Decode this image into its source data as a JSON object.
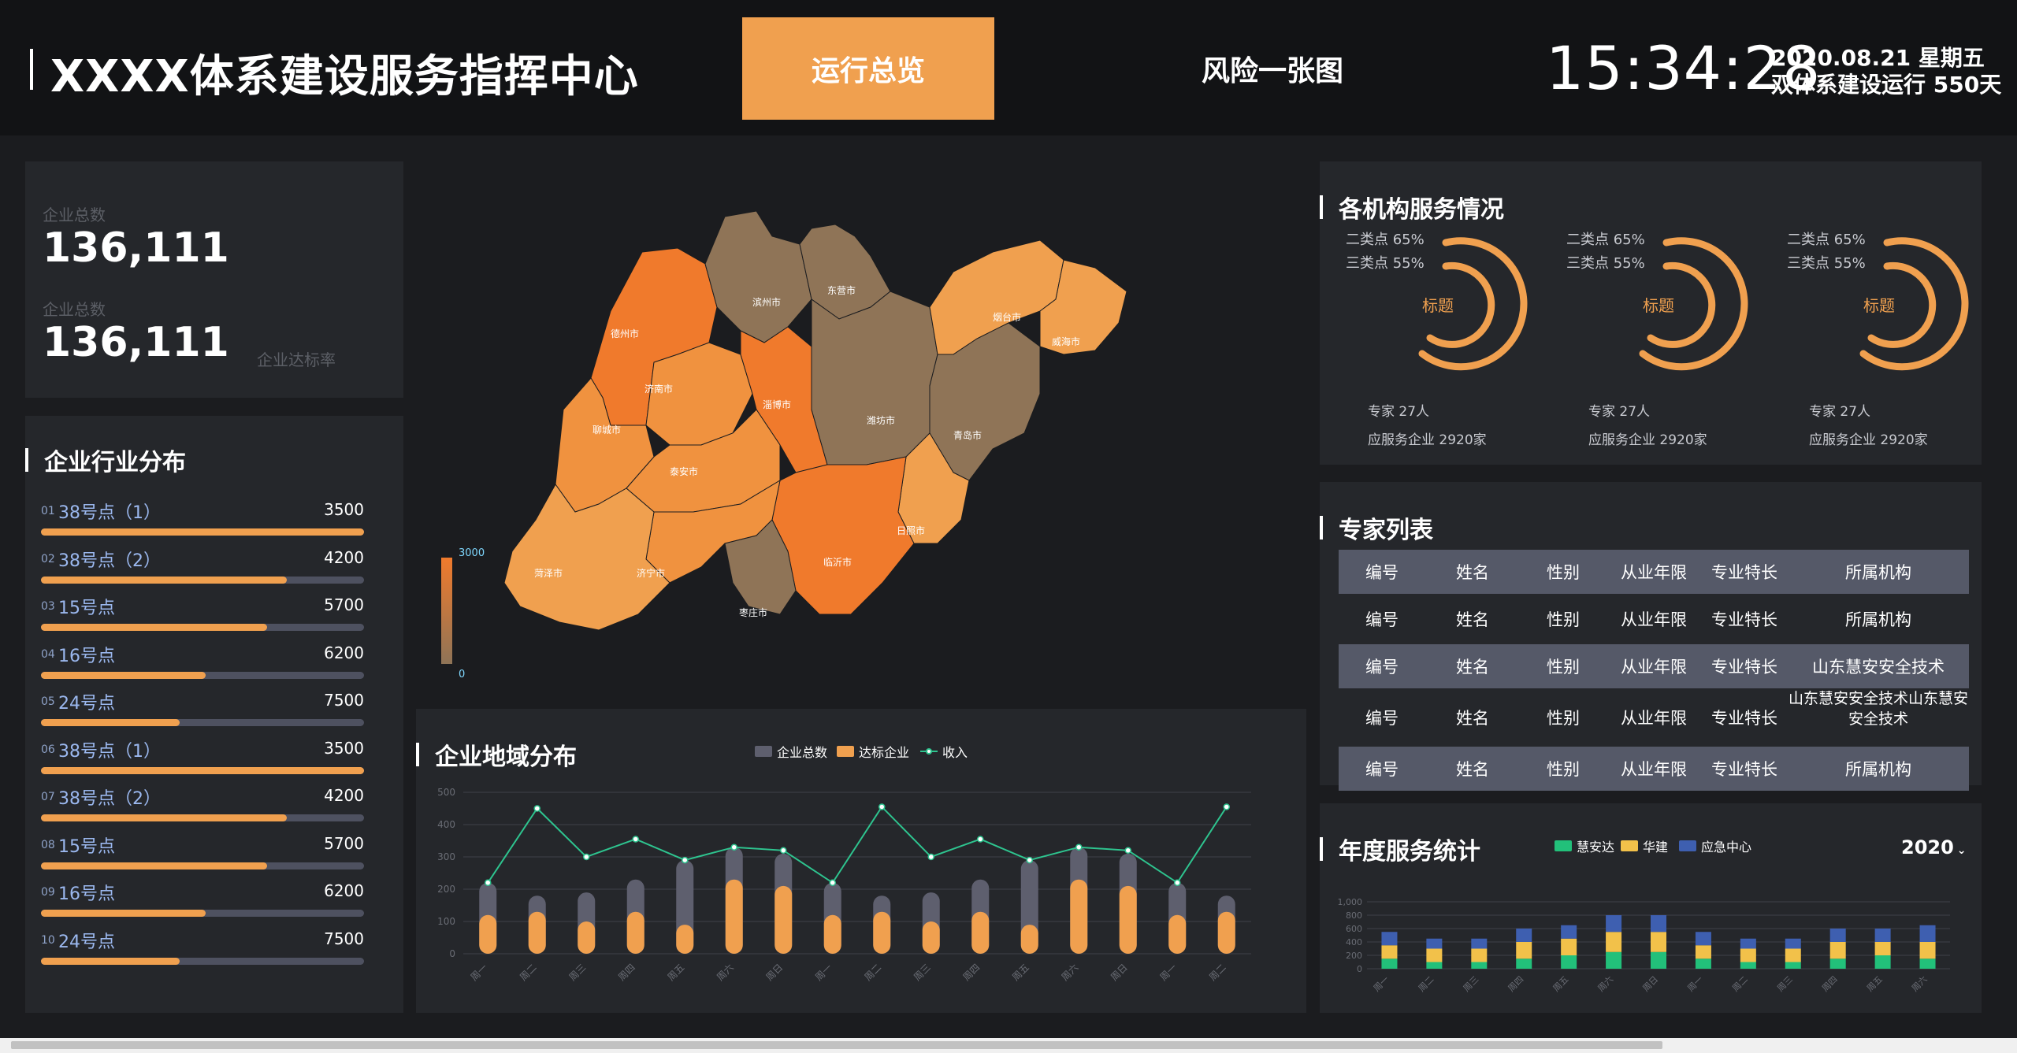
{
  "header": {
    "title": "XXXX体系建设服务指挥中心",
    "tabs": [
      {
        "label": "运行总览"
      },
      {
        "label": "风险一张图"
      }
    ],
    "clock": "15:34:28",
    "date": "2020.08.21 星期五",
    "run_days": "双体系建设运行 550天"
  },
  "kpi": {
    "label1": "企业总数",
    "value1": "136,111",
    "label2": "企业总数",
    "value2": "136,111",
    "rate_label": "企业达标率"
  },
  "industry": {
    "title": "企业行业分布",
    "items": [
      {
        "idx": "01",
        "name": "38号点（1）",
        "value": "3500",
        "pct": 1.0
      },
      {
        "idx": "02",
        "name": "38号点（2）",
        "value": "4200",
        "pct": 0.76
      },
      {
        "idx": "03",
        "name": "15号点",
        "value": "5700",
        "pct": 0.7
      },
      {
        "idx": "04",
        "name": "16号点",
        "value": "6200",
        "pct": 0.51
      },
      {
        "idx": "05",
        "name": "24号点",
        "value": "7500",
        "pct": 0.43
      },
      {
        "idx": "06",
        "name": "38号点（1）",
        "value": "3500",
        "pct": 1.0
      },
      {
        "idx": "07",
        "name": "38号点（2）",
        "value": "4200",
        "pct": 0.76
      },
      {
        "idx": "08",
        "name": "15号点",
        "value": "5700",
        "pct": 0.7
      },
      {
        "idx": "09",
        "name": "16号点",
        "value": "6200",
        "pct": 0.51
      },
      {
        "idx": "10",
        "name": "24号点",
        "value": "7500",
        "pct": 0.43
      }
    ]
  },
  "map": {
    "cities": [
      "德州市",
      "滨州市",
      "东营市",
      "烟台市",
      "威海市",
      "聊城市",
      "济南市",
      "淄博市",
      "潍坊市",
      "青岛市",
      "泰安市",
      "日照市",
      "菏泽市",
      "济宁市",
      "临沂市",
      "枣庄市"
    ],
    "scale_max": "3000",
    "scale_min": "0",
    "colors": {
      "high": "#f07a2c",
      "mid": "#f0923f",
      "light": "#f0a04f",
      "dark": "#8f7457"
    }
  },
  "agency": {
    "title": "各机构服务情况",
    "items": [
      {
        "line1": "二类点 65%",
        "line2": "三类点 55%",
        "center": "标题",
        "experts": "专家 27人",
        "served": "应服务企业 2920家"
      },
      {
        "line1": "二类点 65%",
        "line2": "三类点 55%",
        "center": "标题",
        "experts": "专家 27人",
        "served": "应服务企业 2920家"
      },
      {
        "line1": "二类点 65%",
        "line2": "三类点 55%",
        "center": "标题",
        "experts": "专家 27人",
        "served": "应服务企业 2920家"
      }
    ]
  },
  "experts": {
    "title": "专家列表",
    "header": [
      "编号",
      "姓名",
      "性别",
      "从业年限",
      "专业特长",
      "所属机构"
    ],
    "rows": [
      [
        "编号",
        "姓名",
        "性别",
        "从业年限",
        "专业特长",
        "所属机构"
      ],
      [
        "编号",
        "姓名",
        "性别",
        "从业年限",
        "专业特长",
        "山东慧安安全技术"
      ],
      [
        "编号",
        "姓名",
        "性别",
        "从业年限",
        "专业特长",
        "山东慧安安全技术山东慧安安全技术"
      ],
      [
        "编号",
        "姓名",
        "性别",
        "从业年限",
        "专业特长",
        "所属机构"
      ]
    ]
  },
  "region": {
    "title": "企业地域分布",
    "legend": [
      "企业总数",
      "达标企业",
      "收入"
    ],
    "colors": {
      "total": "#5e5f6e",
      "standard": "#f0a04f",
      "income": "#2ec48f"
    }
  },
  "annual": {
    "title": "年度服务统计",
    "legend": [
      "慧安达",
      "华建",
      "应急中心"
    ],
    "year": "2020",
    "colors": {
      "a": "#22c07a",
      "b": "#f2c14a",
      "c": "#3e5fb0"
    }
  },
  "chart_data": [
    {
      "type": "bar",
      "title": "企业地域分布",
      "categories": [
        "周一",
        "周二",
        "周三",
        "周四",
        "周五",
        "周六",
        "周日",
        "周一",
        "周二",
        "周三",
        "周四",
        "周五",
        "周六",
        "周日",
        "周一",
        "周二"
      ],
      "ylim": [
        0,
        500
      ],
      "yticks": [
        "0",
        "100",
        "200",
        "300",
        "400",
        "500"
      ],
      "series": [
        {
          "name": "企业总数",
          "values": [
            220,
            180,
            190,
            230,
            290,
            330,
            310,
            220,
            180,
            190,
            230,
            290,
            330,
            310,
            220,
            180
          ]
        },
        {
          "name": "达标企业",
          "values": [
            120,
            130,
            100,
            130,
            90,
            230,
            210,
            120,
            130,
            100,
            130,
            90,
            230,
            210,
            120,
            130
          ]
        },
        {
          "name": "收入",
          "values": [
            220,
            450,
            300,
            355,
            290,
            330,
            320,
            220,
            455,
            300,
            355,
            290,
            330,
            320,
            220,
            455
          ]
        }
      ],
      "grid": true,
      "legend": "top"
    },
    {
      "type": "bar",
      "title": "年度服务统计",
      "categories": [
        "周一",
        "周二",
        "周三",
        "周四",
        "周五",
        "周六",
        "周日",
        "周一",
        "周二",
        "周三",
        "周四",
        "周五",
        "周六"
      ],
      "ylim": [
        0,
        1000
      ],
      "yticks": [
        "0",
        "200",
        "400",
        "600",
        "800",
        "1,000"
      ],
      "series": [
        {
          "name": "慧安达",
          "values": [
            150,
            100,
            100,
            150,
            200,
            250,
            250,
            150,
            100,
            100,
            150,
            200,
            150
          ]
        },
        {
          "name": "华建",
          "values": [
            200,
            200,
            200,
            250,
            250,
            300,
            300,
            200,
            200,
            200,
            250,
            200,
            250
          ]
        },
        {
          "name": "应急中心",
          "values": [
            200,
            150,
            150,
            200,
            200,
            250,
            250,
            200,
            150,
            150,
            200,
            200,
            250
          ]
        }
      ],
      "stacked": true,
      "grid": true,
      "legend": "top"
    }
  ]
}
